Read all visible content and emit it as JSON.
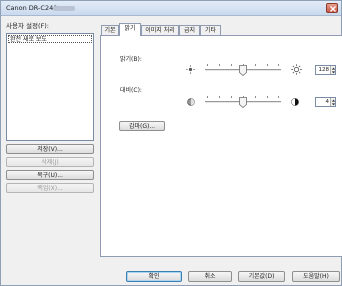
{
  "window": {
    "title": "Canon DR-C240"
  },
  "sidebar": {
    "user_settings_label": "사용자 설정(F):",
    "list_items": [
      "완전 새로 보도"
    ],
    "buttons": {
      "save": "저장(V)...",
      "delete": "삭제(J)",
      "restore": "복구(U)...",
      "backup": "백업(X)..."
    }
  },
  "tabs": [
    "기본",
    "밝기",
    "이미지 처리",
    "급지",
    "기타"
  ],
  "active_tab": "밝기",
  "brightness": {
    "label": "밝기(B):",
    "value": "128",
    "level": 0.5
  },
  "contrast": {
    "label": "대비(C):",
    "value": "4",
    "level": 0.5
  },
  "gamma_button": "감마(G)...",
  "footer": {
    "ok": "확인",
    "cancel": "취소",
    "defaults": "기본값(D)",
    "help": "도움말(H)"
  },
  "colors": {
    "accent": "#3c7fb1",
    "titlebar": "#c9d9ee",
    "close": "#c75844"
  }
}
